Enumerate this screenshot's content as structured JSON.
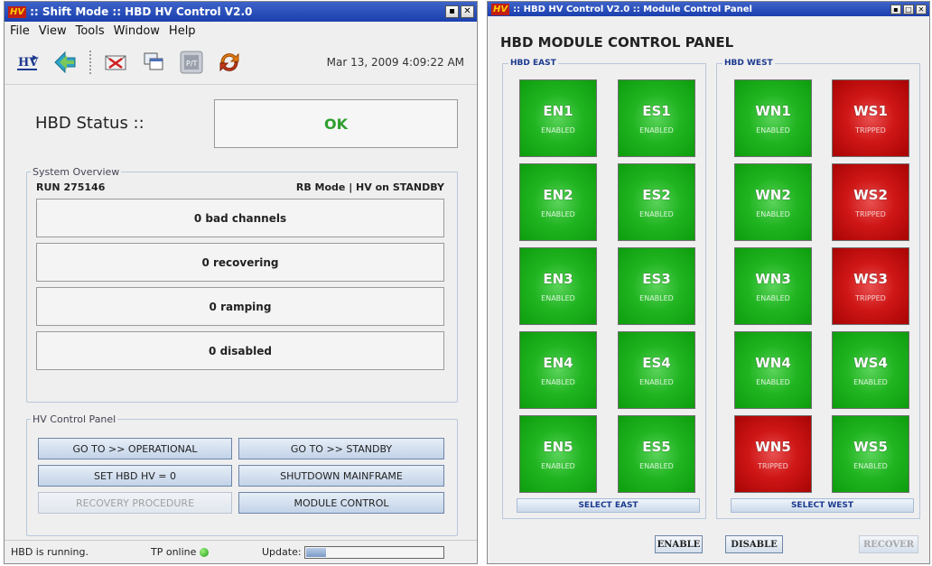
{
  "left_window": {
    "title": ":: Shift Mode :: HBD HV Control V2.0",
    "logo_text": "HV",
    "menu": [
      "File",
      "View",
      "Tools",
      "Window",
      "Help"
    ],
    "datetime": "Mar 13, 2009 4:09:22 AM",
    "toolbar_icons": [
      "hv-icon",
      "arrow-icon",
      "mail-icon",
      "window-icon",
      "pt-icon",
      "refresh-icon"
    ],
    "status": {
      "label": "HBD Status ::",
      "value": "OK",
      "color": "#2e9e2e"
    },
    "overview": {
      "legend": "System Overview",
      "run": "RUN 275146",
      "mode": "RB Mode | HV on STANDBY",
      "rows": [
        "0 bad channels",
        "0 recovering",
        "0 ramping",
        "0 disabled"
      ]
    },
    "control_panel": {
      "legend": "HV Control Panel",
      "buttons": [
        {
          "label": "GO TO >> OPERATIONAL",
          "enabled": true
        },
        {
          "label": "GO TO >> STANDBY",
          "enabled": true
        },
        {
          "label": "SET HBD HV = 0",
          "enabled": true
        },
        {
          "label": "SHUTDOWN MAINFRAME",
          "enabled": true
        },
        {
          "label": "RECOVERY PROCEDURE",
          "enabled": false
        },
        {
          "label": "MODULE CONTROL",
          "enabled": true
        }
      ]
    },
    "statusbar": {
      "message": "HBD is running.",
      "tp_label": "TP online",
      "update_label": "Update:",
      "update_progress": 0.15
    }
  },
  "right_window": {
    "title": ":: HBD HV Control V2.0 :: Module Control Panel",
    "logo_text": "HV",
    "heading": "HBD MODULE CONTROL PANEL",
    "east": {
      "legend": "HBD EAST",
      "select_label": "SELECT EAST",
      "modules": [
        {
          "name": "EN1",
          "state": "ENABLED"
        },
        {
          "name": "ES1",
          "state": "ENABLED"
        },
        {
          "name": "EN2",
          "state": "ENABLED"
        },
        {
          "name": "ES2",
          "state": "ENABLED"
        },
        {
          "name": "EN3",
          "state": "ENABLED"
        },
        {
          "name": "ES3",
          "state": "ENABLED"
        },
        {
          "name": "EN4",
          "state": "ENABLED"
        },
        {
          "name": "ES4",
          "state": "ENABLED"
        },
        {
          "name": "EN5",
          "state": "ENABLED"
        },
        {
          "name": "ES5",
          "state": "ENABLED"
        }
      ]
    },
    "west": {
      "legend": "HBD WEST",
      "select_label": "SELECT WEST",
      "modules": [
        {
          "name": "WN1",
          "state": "ENABLED"
        },
        {
          "name": "WS1",
          "state": "TRIPPED"
        },
        {
          "name": "WN2",
          "state": "ENABLED"
        },
        {
          "name": "WS2",
          "state": "TRIPPED"
        },
        {
          "name": "WN3",
          "state": "ENABLED"
        },
        {
          "name": "WS3",
          "state": "TRIPPED"
        },
        {
          "name": "WN4",
          "state": "ENABLED"
        },
        {
          "name": "WS4",
          "state": "ENABLED"
        },
        {
          "name": "WN5",
          "state": "TRIPPED"
        },
        {
          "name": "WS5",
          "state": "ENABLED"
        }
      ]
    },
    "actions": {
      "enable": "ENABLE",
      "disable": "DISABLE",
      "recover": "RECOVER"
    },
    "colors": {
      "enabled": "#21b521",
      "tripped": "#cf1616"
    }
  }
}
